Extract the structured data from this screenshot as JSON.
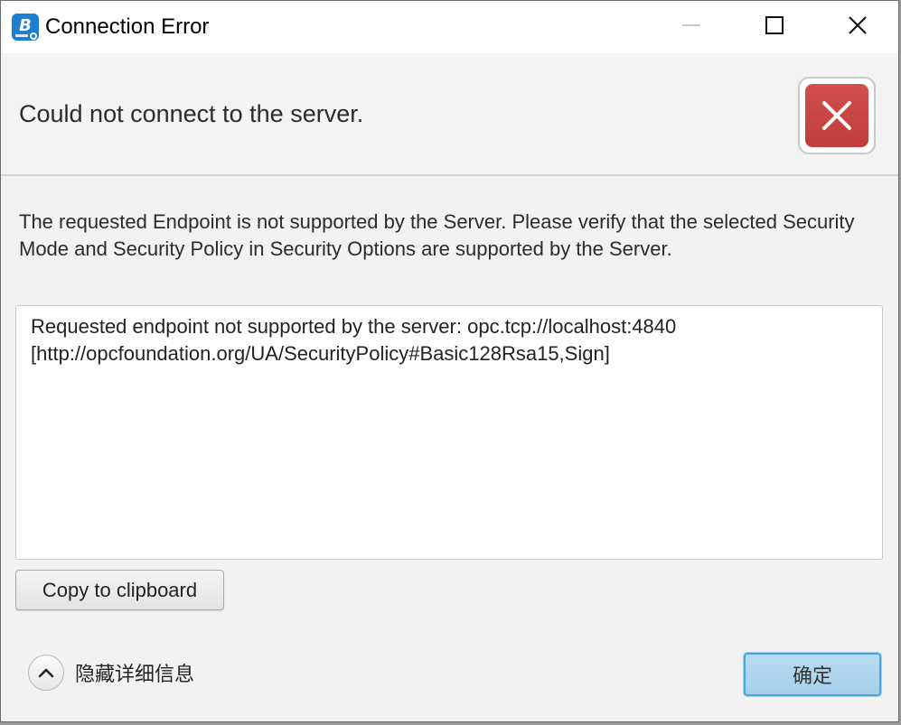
{
  "window": {
    "title": "Connection Error",
    "app_icon": "b-app-icon"
  },
  "window_controls": {
    "minimize_icon": "minimize-icon",
    "maximize_icon": "maximize-icon",
    "close_icon": "close-icon"
  },
  "header": {
    "text": "Could not connect to the server.",
    "badge_icon": "error-x-icon",
    "badge_color": "#c9433f"
  },
  "message": "The requested Endpoint is not supported by the Server. Please verify that the selected Security Mode and Security Policy in Security Options are supported by the Server.",
  "details": "Requested endpoint not supported by the server: opc.tcp://localhost:4840\n[http://opcfoundation.org/UA/SecurityPolicy#Basic128Rsa15,Sign]",
  "buttons": {
    "copy_label": "Copy to clipboard",
    "toggle_details_label": "隐藏详细信息",
    "toggle_icon": "chevron-up-icon",
    "ok_label": "确定"
  },
  "colors": {
    "accent": "#4aa6d6",
    "ok_fill": "#b0d7ef"
  }
}
